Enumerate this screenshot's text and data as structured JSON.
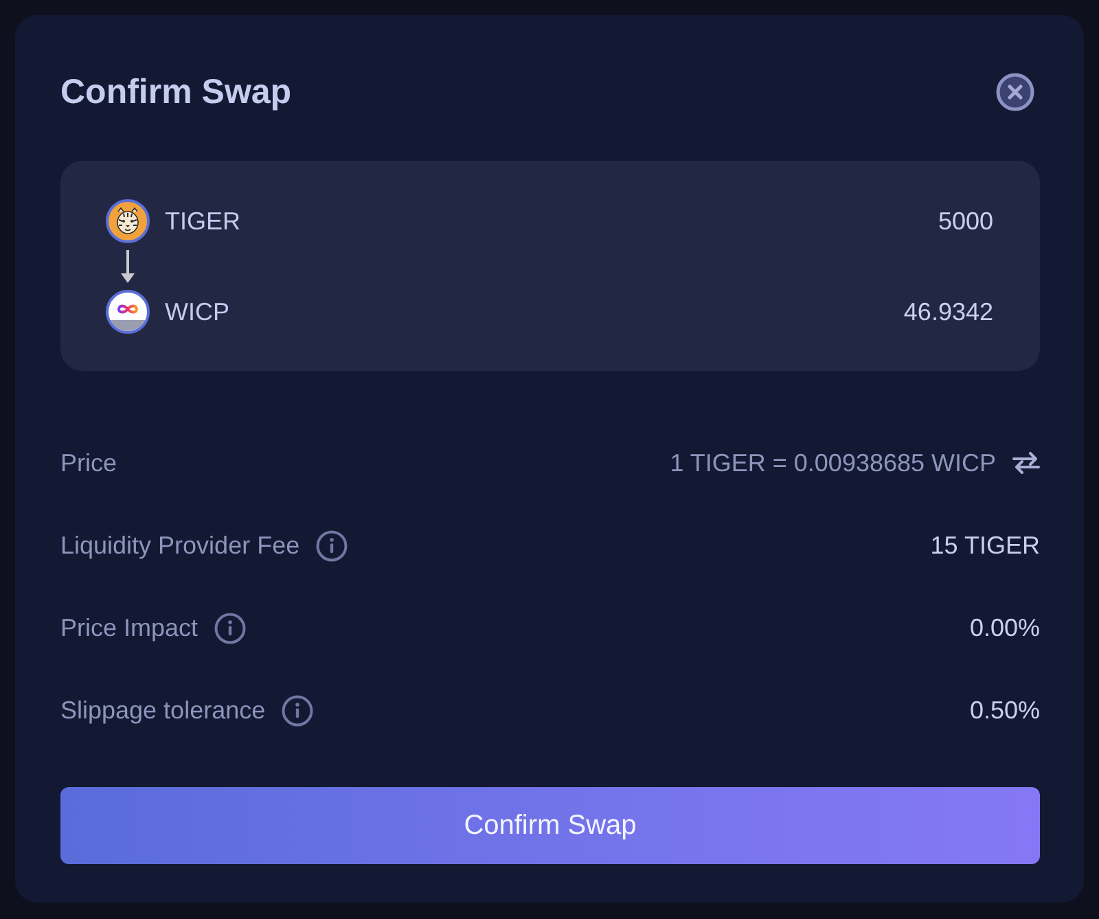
{
  "dialog": {
    "title": "Confirm Swap"
  },
  "tokens": [
    {
      "kind": "tiger",
      "symbol": "TIGER",
      "amount": "5000"
    },
    {
      "kind": "wicp",
      "symbol": "WICP",
      "amount": "46.9342"
    }
  ],
  "details": [
    {
      "kind": "price",
      "label": "Price",
      "value": "1 TIGER = 0.00938685 WICP"
    },
    {
      "kind": "info",
      "label": "Liquidity Provider Fee",
      "value": "15 TIGER"
    },
    {
      "kind": "info",
      "label": "Price Impact",
      "value": "0.00%"
    },
    {
      "kind": "info",
      "label": "Slippage tolerance",
      "value": "0.50%"
    }
  ],
  "confirm_button": {
    "label": "Confirm Swap"
  }
}
